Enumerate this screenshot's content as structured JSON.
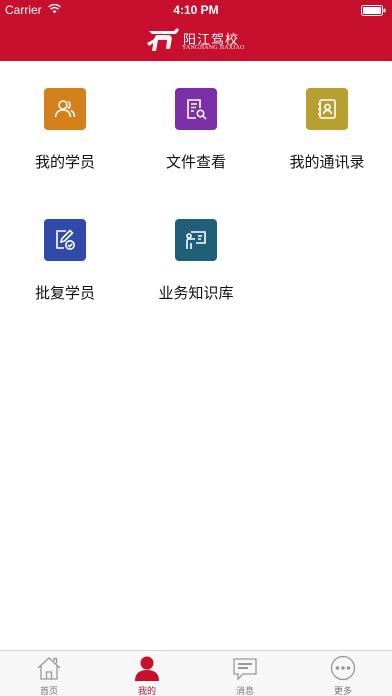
{
  "status_bar": {
    "carrier": "Carrier",
    "time": "4:10 PM"
  },
  "header": {
    "brand_title": "阳江驾校",
    "brand_subtitle": "YANGJIANG JIAXIAO",
    "brand_color": "#c8102e"
  },
  "menu": {
    "items": [
      {
        "label": "我的学员",
        "icon": "users-icon",
        "color": "#d4811c"
      },
      {
        "label": "文件查看",
        "icon": "document-search-icon",
        "color": "#7b2fa8"
      },
      {
        "label": "我的通讯录",
        "icon": "contacts-icon",
        "color": "#b8a030"
      },
      {
        "label": "批复学员",
        "icon": "edit-approve-icon",
        "color": "#2f4aa8"
      },
      {
        "label": "业务知识库",
        "icon": "presentation-icon",
        "color": "#1f5f7a"
      }
    ]
  },
  "tabbar": {
    "tabs": [
      {
        "label": "首页",
        "icon": "home-icon",
        "active": false
      },
      {
        "label": "我的",
        "icon": "person-icon",
        "active": true
      },
      {
        "label": "消息",
        "icon": "message-icon",
        "active": false
      },
      {
        "label": "更多",
        "icon": "more-icon",
        "active": false
      }
    ],
    "active_color": "#c8102e",
    "inactive_color": "#999999"
  }
}
